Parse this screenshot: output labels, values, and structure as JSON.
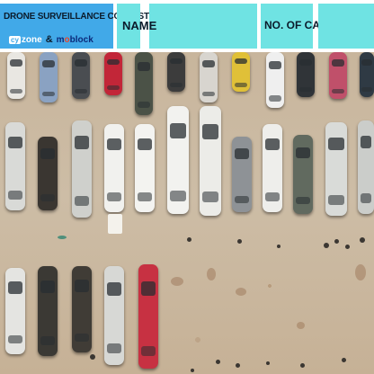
{
  "header": {
    "title": "DRONE SURVEILLANCE CONTEST",
    "logos": {
      "left": "zone",
      "left_badge": "cy",
      "ampersand": "&",
      "right_prefix": "m",
      "right_o": "o",
      "right_suffix": "block"
    },
    "name_field": {
      "label": "NAME",
      "value": ""
    },
    "cars_field": {
      "label": "NO. OF CARS",
      "value": ""
    }
  },
  "colors": {
    "title_panel": "#41a9e8",
    "field_panel": "#6fe3e3",
    "ground": "#c9b79f"
  }
}
